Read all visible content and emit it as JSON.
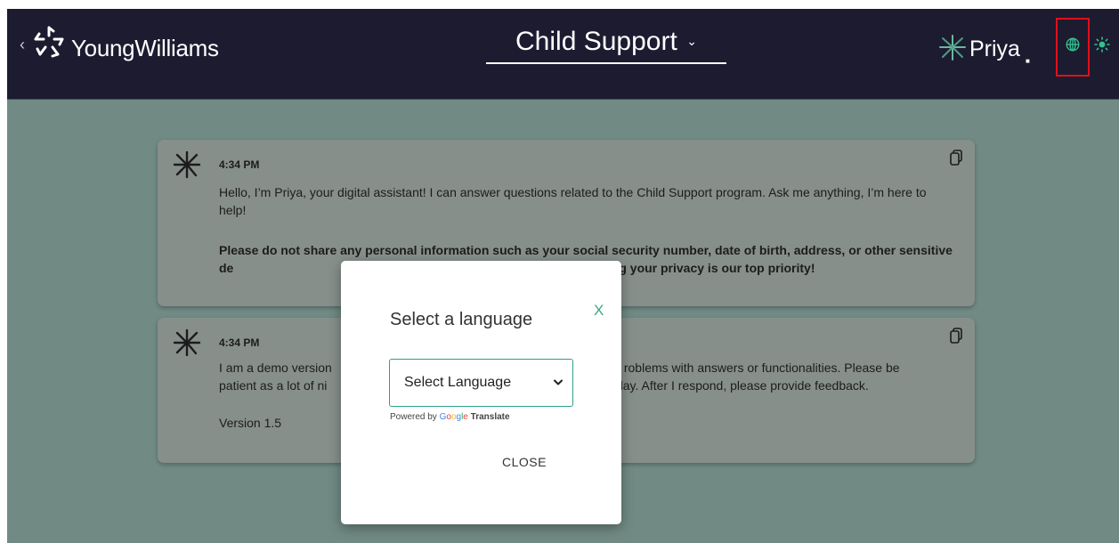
{
  "header": {
    "back_glyph": "‹",
    "brand_name": "YoungWilliams",
    "program_select": {
      "label": "Child Support",
      "chevron": "⌄"
    },
    "assistant_name": "Priya",
    "assistant_dot": "■",
    "icons": [
      "young-williams-logo-icon",
      "priya-logo-icon",
      "globe-icon",
      "sun-icon"
    ],
    "highlight_color": "#e0101a"
  },
  "chat": {
    "messages": [
      {
        "time": "4:34 PM",
        "text": "Hello, I’m Priya, your digital assistant! I can answer questions related to the Child Support program. Ask me anything, I’m here to help!",
        "bold_text": "Please do not share any personal information such as your social security number, date of birth, address, or other sensitive de",
        "bold_tail": "ut protecting your privacy is our top priority!"
      },
      {
        "time": "4:34 PM",
        "text_left": "I am a demo version",
        "text_right": "roblems with answers or functionalities. Please be",
        "text2_left": "patient as a lot of ni",
        "text2_right": "ry day. After I respond, please provide feedback.",
        "version": "Version 1.5"
      }
    ]
  },
  "modal": {
    "title": "Select a language",
    "close_x": "X",
    "select_label": "Select Language",
    "powered_by": "Powered by",
    "google_letters": [
      "G",
      "o",
      "o",
      "g",
      "l",
      "e"
    ],
    "translate": "Translate",
    "close_button": "CLOSE"
  },
  "colors": {
    "header_bg": "#1c1b30",
    "overlay_bg": "#718a84",
    "card_bg": "#878f8b",
    "accent_teal": "#2ea088"
  }
}
